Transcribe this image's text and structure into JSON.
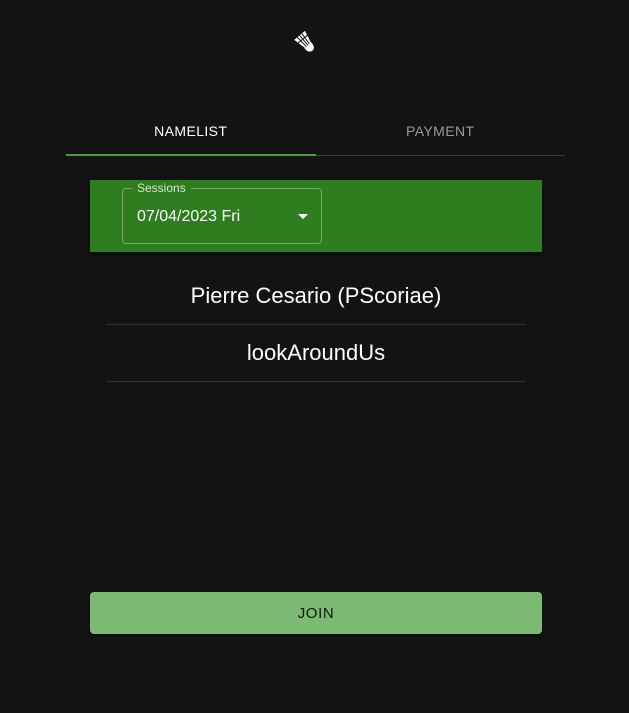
{
  "header": {
    "logo_icon": "shuttlecock-icon"
  },
  "tabs": [
    {
      "label": "NAMELIST",
      "active": true
    },
    {
      "label": "PAYMENT",
      "active": false
    }
  ],
  "sessions": {
    "label": "Sessions",
    "selected": "07/04/2023 Fri"
  },
  "namelist": [
    "Pierre Cesario (PScoriae)",
    "lookAroundUs"
  ],
  "actions": {
    "join_label": "JOIN"
  },
  "colors": {
    "background": "#131313",
    "panel": "#2e7d1e",
    "join_button": "#7cb972",
    "tab_indicator": "#4c9a3e"
  }
}
